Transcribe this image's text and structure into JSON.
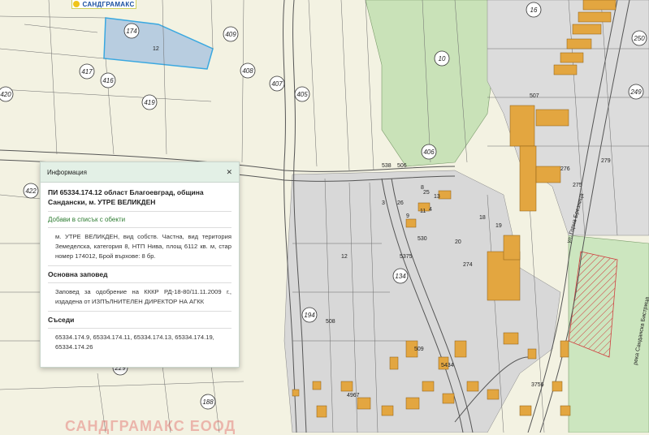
{
  "map": {
    "circle_parcels": [
      "174",
      "409",
      "417",
      "416",
      "419",
      "420",
      "408",
      "407",
      "405",
      "10",
      "406",
      "16",
      "134",
      "194",
      "422",
      "229",
      "188",
      "249",
      "250"
    ],
    "parcel_labels": [
      "12",
      "12",
      "506",
      "507",
      "508",
      "509",
      "538",
      "530",
      "5375",
      "5434",
      "274",
      "275",
      "276",
      "279",
      "3756",
      "4967",
      "26",
      "25",
      "13",
      "11",
      "9",
      "8",
      "4",
      "3",
      "18",
      "19",
      "20"
    ],
    "street_labels": [
      "ул. Горна Брезница",
      "река Санданска Бистрица"
    ]
  },
  "logo": {
    "text": "САНДГРАМАКС"
  },
  "watermark": "САНДГРАМАКС ЕООД",
  "popup": {
    "title": "Информация",
    "close_icon": "close-icon",
    "parcel_heading": "ПИ 65334.174.12 област Благоевград, община Сандански, м. УТРЕ ВЕЛИКДЕН",
    "add_link": "Добави в списък с обекти",
    "description": "м. УТРЕ ВЕЛИКДЕН, вид собств. Частна, вид територия Земеделска, категория 8, НТП Нива, площ 6112 кв. м, стар номер 174012, Брой върхове: 8 бр.",
    "order_title": "Основна заповед",
    "order_text": "Заповед за одобрение на КККР РД-18-80/11.11.2009 г., издадена от ИЗПЪЛНИТЕЛЕН ДИРЕКТОР НА АГКК",
    "neighbors_title": "Съседи",
    "neighbors_text": "65334.174.9, 65334.174.11, 65334.174.13, 65334.174.19, 65334.174.26"
  },
  "colors": {
    "agri": "#f2f1e0",
    "forest": "#c7e0b8",
    "urban": "#d9d9d9",
    "building": "#e3a640",
    "selected": "#b8cde0",
    "selected_stroke": "#3aa8e0",
    "accent_green": "#2e7d32"
  }
}
